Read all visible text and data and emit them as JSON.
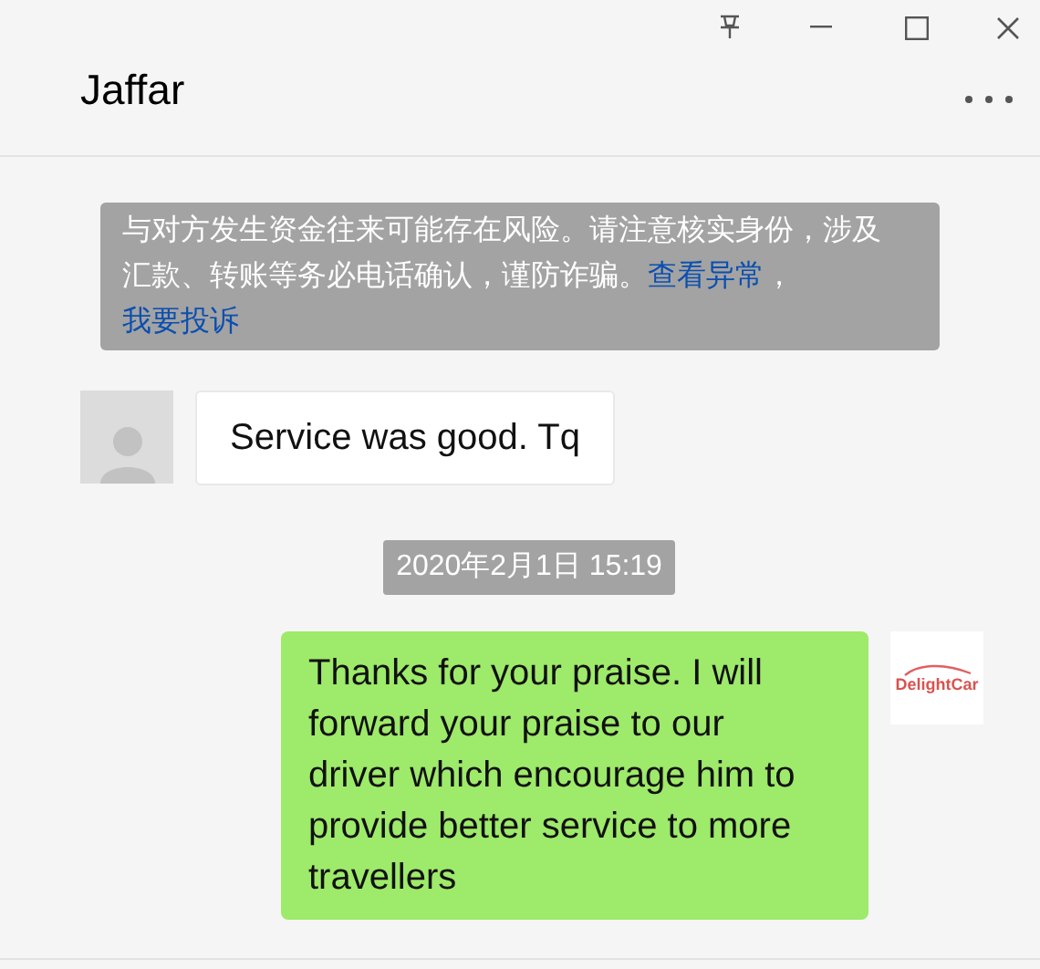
{
  "window": {
    "title": "Jaffar"
  },
  "notice": {
    "parts": [
      {
        "kind": "text",
        "text": "与对方发生资金往来可能存在风险。请注意核实身份，涉及汇款、转账等务必电话确认，谨防诈骗。"
      },
      {
        "kind": "link",
        "text": "查看异常"
      },
      {
        "kind": "text",
        "text": "，"
      },
      {
        "kind": "link",
        "text": "我要投诉"
      }
    ]
  },
  "messages": [
    {
      "kind": "incoming",
      "text": "Service was good. Tq"
    },
    {
      "kind": "timestamp",
      "text": "2020年2月1日 15:19"
    },
    {
      "kind": "outgoing",
      "text": "Thanks for your praise. I will forward your praise to our driver which encourage him to provide better service to more travellers",
      "avatar_text": "DelightCar"
    }
  ]
}
